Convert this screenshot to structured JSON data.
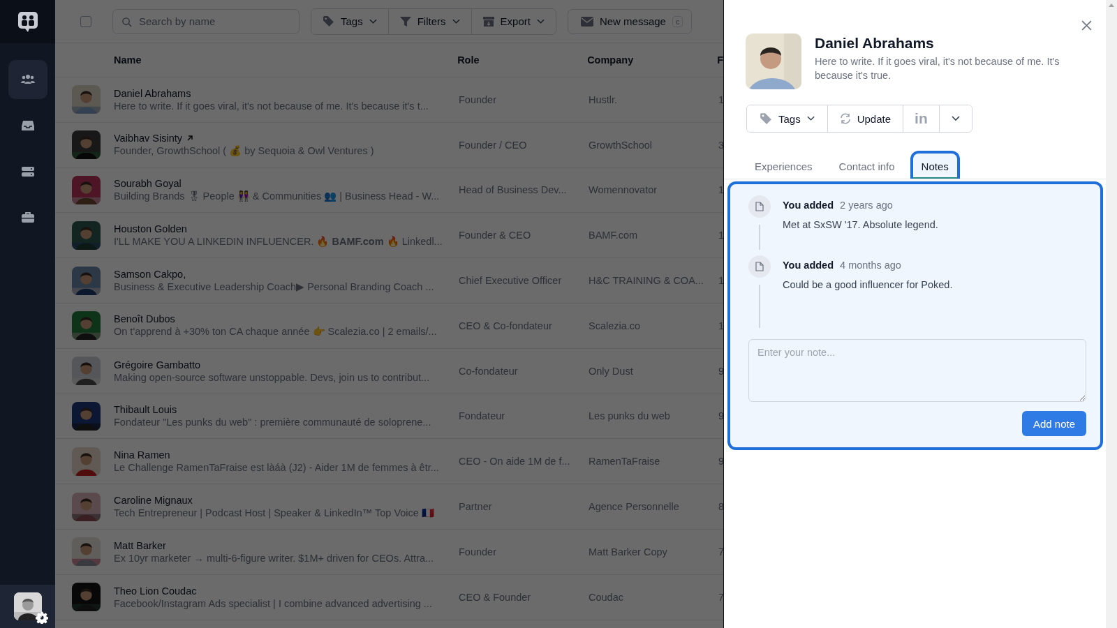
{
  "sidebar": {
    "items": [
      {
        "selected": true
      },
      {
        "selected": false
      },
      {
        "selected": false
      },
      {
        "selected": false
      }
    ]
  },
  "toolbar": {
    "select_all": {
      "checked": false
    },
    "search": {
      "placeholder": "Search by name"
    },
    "buttons": [
      {
        "label": "Tags",
        "kind": "tag"
      },
      {
        "label": "Filters",
        "kind": "filter"
      },
      {
        "label": "Export",
        "kind": "export"
      }
    ],
    "new_message": {
      "label": "New message",
      "shortcut": "c"
    }
  },
  "table": {
    "columns": [
      "Name",
      "Role",
      "Company",
      "F"
    ],
    "rows": [
      {
        "name": "Daniel Abrahams",
        "external": false,
        "bio": "Here to write. If it goes viral, it's not because of me. It's because it's t...",
        "role": "Founder",
        "company": "Hustlr.",
        "column_4": "1"
      },
      {
        "name": "Vaibhav Sisinty",
        "external": true,
        "bio": "Founder, GrowthSchool ( 💰 by Sequoia & Owl Ventures )",
        "role": "Founder / CEO",
        "company": "GrowthSchool",
        "column_4": "3"
      },
      {
        "name": "Sourabh Goyal",
        "external": false,
        "bio": "Building Brands 🎖 People 👭 & Communities 👥 | Business Head - W...",
        "role": "Head of Business Dev...",
        "company": "Womennovator",
        "column_4": "1"
      },
      {
        "name": "Houston Golden",
        "external": false,
        "bio": "I'LL MAKE YOU A LINKEDIN INFLUENCER. 🔥 **BAMF.com** 🔥 Linkedl...",
        "role": "Founder & CEO",
        "company": "BAMF.com",
        "column_4": "1"
      },
      {
        "name": "Samson Cakpo,",
        "external": false,
        "bio": "Business & Executive Leadership Coach▶ Personal Branding Coach ...",
        "role": "Chief Executive Officer",
        "company": "H&C TRAINING & COA...",
        "column_4": "1"
      },
      {
        "name": "Benoît Dubos",
        "external": false,
        "bio": "On t'apprend à +30% ton CA chaque année 👉 Scalezia.co | 2 emails/...",
        "role": "CEO & Co-fondateur",
        "company": "Scalezia.co",
        "column_4": "1"
      },
      {
        "name": "Grégoire Gambatto",
        "external": false,
        "bio": "Making open-source software unstoppable. Devs, join us to contribut...",
        "role": "Co-fondateur",
        "company": "Only Dust",
        "column_4": "9"
      },
      {
        "name": "Thibault Louis",
        "external": false,
        "bio": "Fondateur \"Les punks du web\" : première communauté de soloprene...",
        "role": "Fondateur",
        "company": "Les punks du web",
        "column_4": "9"
      },
      {
        "name": "Nina Ramen",
        "external": false,
        "bio": "Le Challenge RamenTaFraise est làáà (J2) - Aider 1M de femmes à êtr...",
        "role": "CEO - On aide 1M de f...",
        "company": "RamenTaFraise",
        "column_4": "9"
      },
      {
        "name": "Caroline Mignaux",
        "external": false,
        "bio": "Tech Entrepreneur | Podcast Host | Speaker & LinkedIn™ Top Voice 🇫🇷",
        "role": "Partner",
        "company": "Agence Personnelle",
        "column_4": "8"
      },
      {
        "name": "Matt Barker",
        "external": false,
        "bio": "Ex 10yr marketer → multi-6-figure writer. $1M+ driven for CEOs. Attra...",
        "role": "Founder",
        "company": "Matt Barker Copy",
        "column_4": "7"
      },
      {
        "name": "Theo Lion Coudac",
        "external": false,
        "bio": "Facebook/Instagram Ads specialist | I combine advanced advertising ...",
        "role": "CEO & Founder",
        "company": "Coudac",
        "column_4": "7"
      }
    ]
  },
  "panel": {
    "name": "Daniel Abrahams",
    "bio": "Here to write. If it goes viral, it's not because of me. It's because it's true.",
    "actions": [
      {
        "kind": "tags",
        "label": "Tags"
      },
      {
        "kind": "update",
        "label": "Update"
      },
      {
        "kind": "linkedin",
        "label": "in"
      },
      {
        "kind": "more"
      }
    ],
    "tabs": [
      {
        "label": "Experiences",
        "selected": false,
        "highlighted": false
      },
      {
        "label": "Contact info",
        "selected": false,
        "highlighted": false
      },
      {
        "label": "Notes",
        "selected": true,
        "highlighted": true
      }
    ],
    "notes_highlighted": true,
    "notes": [
      {
        "author": "You added",
        "time": "2 years ago",
        "text": "Met at SxSW '17. Absolute legend."
      },
      {
        "author": "You added",
        "time": "4 months ago",
        "text": "Could be a good influencer for Poked."
      }
    ],
    "note_input": {
      "placeholder": "Enter your note..."
    },
    "add_button": "Add note"
  }
}
